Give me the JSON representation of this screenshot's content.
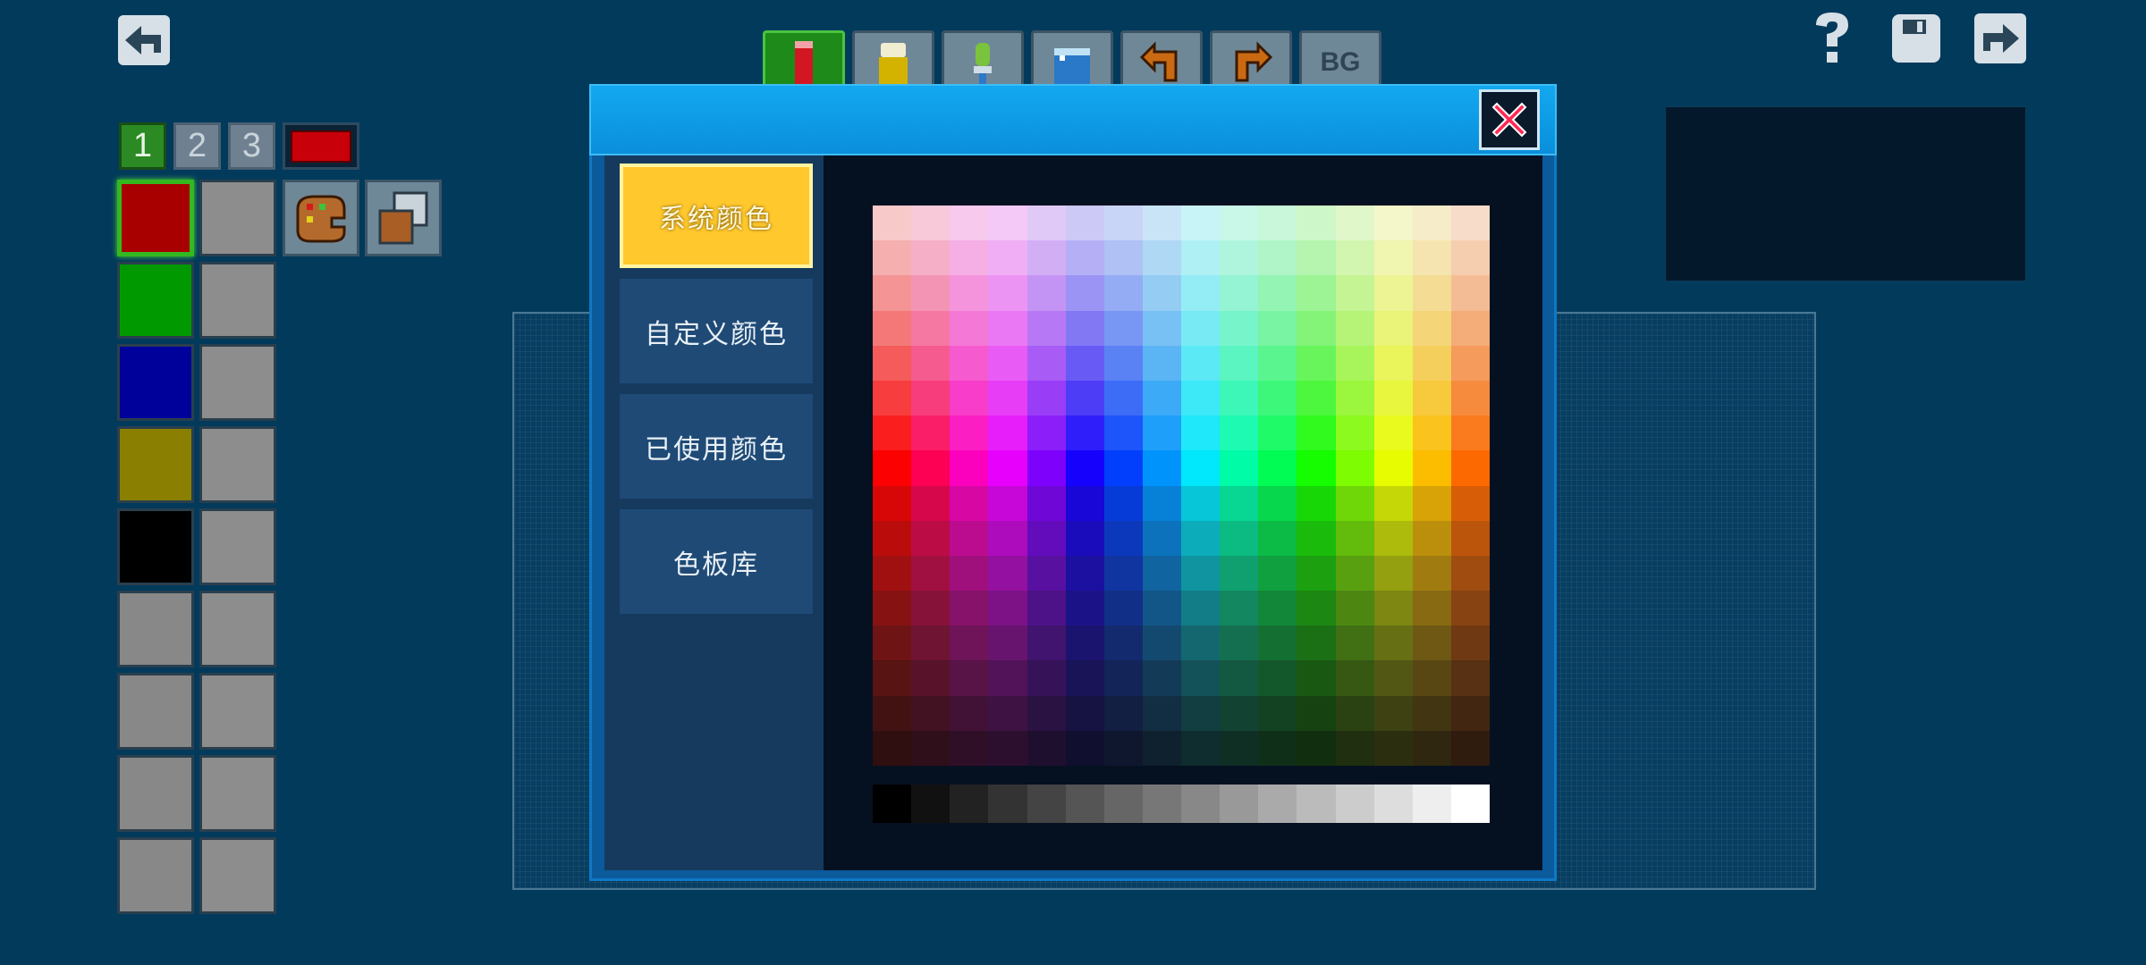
{
  "toolbar": {
    "tools": [
      "pencil-icon",
      "eraser-icon",
      "dropper-icon",
      "bucket-icon",
      "undo-icon",
      "redo-icon",
      "background-icon"
    ],
    "bg_label": "BG"
  },
  "layers": {
    "tabs": [
      "1",
      "2",
      "3"
    ],
    "active": "1",
    "current_color": "#c8000a"
  },
  "palette": {
    "colors": [
      "#a80000",
      "#009a00",
      "#00009a",
      "#8a7f00",
      "#000000",
      "#888888",
      "#888888",
      "#888888",
      "#888888"
    ],
    "secondary": "#8d8d8d"
  },
  "dialog": {
    "tabs": [
      {
        "label": "系统颜色",
        "active": true
      },
      {
        "label": "自定义颜色",
        "active": false
      },
      {
        "label": "已使用颜色",
        "active": false
      },
      {
        "label": "色板库",
        "active": false
      }
    ],
    "close_icon": "close-x-icon",
    "grid_description": "16 hue columns x 16 tone rows + grayscale row"
  },
  "colors": {
    "background": "#023a5c",
    "dialog_header": "#13a8f0",
    "active_tab": "#ffc82c",
    "tab": "#1f4a76",
    "close_x": "#ff2a54"
  }
}
